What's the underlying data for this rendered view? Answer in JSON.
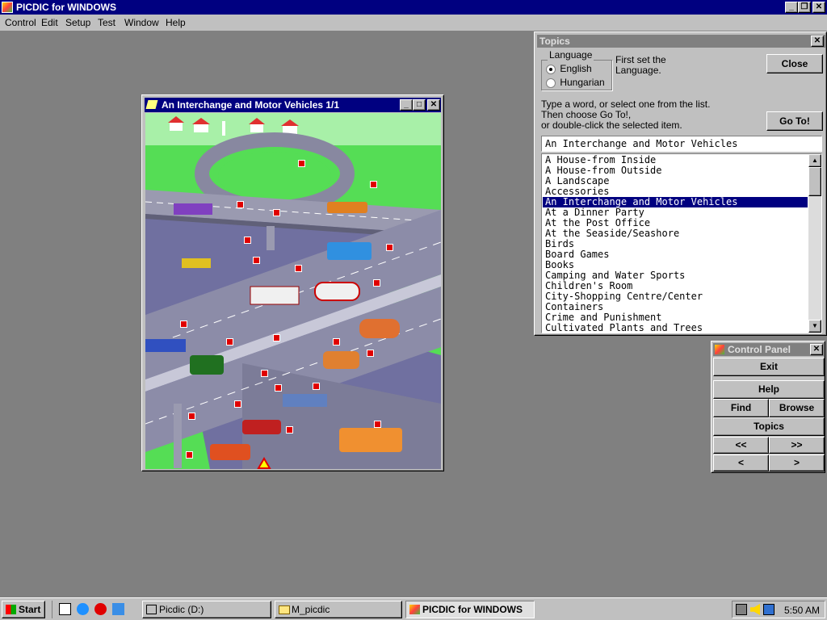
{
  "app": {
    "title": "PICDIC for WINDOWS"
  },
  "menu": [
    "Control",
    "Edit",
    "Setup",
    "Test",
    "Window",
    "Help"
  ],
  "picture_window": {
    "title": "An Interchange and Motor Vehicles 1/1"
  },
  "topics": {
    "title": "Topics",
    "language_group_label": "Language",
    "languages": [
      "English",
      "Hungarian"
    ],
    "selected_language": "English",
    "language_hint": "First set the Language.",
    "close_label": "Close",
    "instructions": [
      "Type a word, or select one from the list.",
      "Then choose Go To!,",
      "or double-click the selected item."
    ],
    "goto_label": "Go To!",
    "search_value": "An Interchange and Motor Vehicles",
    "items": [
      "A House-from Inside",
      "A House-from Outside",
      "A Landscape",
      "Accessories",
      "An Interchange and Motor Vehicles",
      "At a Dinner Party",
      "At the Post Office",
      "At the Seaside/Seashore",
      "Birds",
      "Board Games",
      "Books",
      "Camping and Water Sports",
      "Children's Room",
      "City-Shopping Centre/Center",
      "Containers",
      "Crime and Punishment",
      "Cultivated Plants and Trees"
    ],
    "selected_index": 4
  },
  "control_panel": {
    "title": "Control Panel",
    "exit": "Exit",
    "help": "Help",
    "find": "Find",
    "browse": "Browse",
    "topics": "Topics",
    "first": "<<",
    "last": ">>",
    "prev": "<",
    "next": ">"
  },
  "taskbar": {
    "start": "Start",
    "tasks": [
      "Picdic (D:)",
      "M_picdic",
      "PICDIC for WINDOWS"
    ],
    "active_task": 2,
    "clock": "5:50 AM"
  },
  "colors": {
    "title_active": "#000080",
    "selection": "#000080",
    "desktop": "#808080",
    "hotspot": "#e00000"
  }
}
